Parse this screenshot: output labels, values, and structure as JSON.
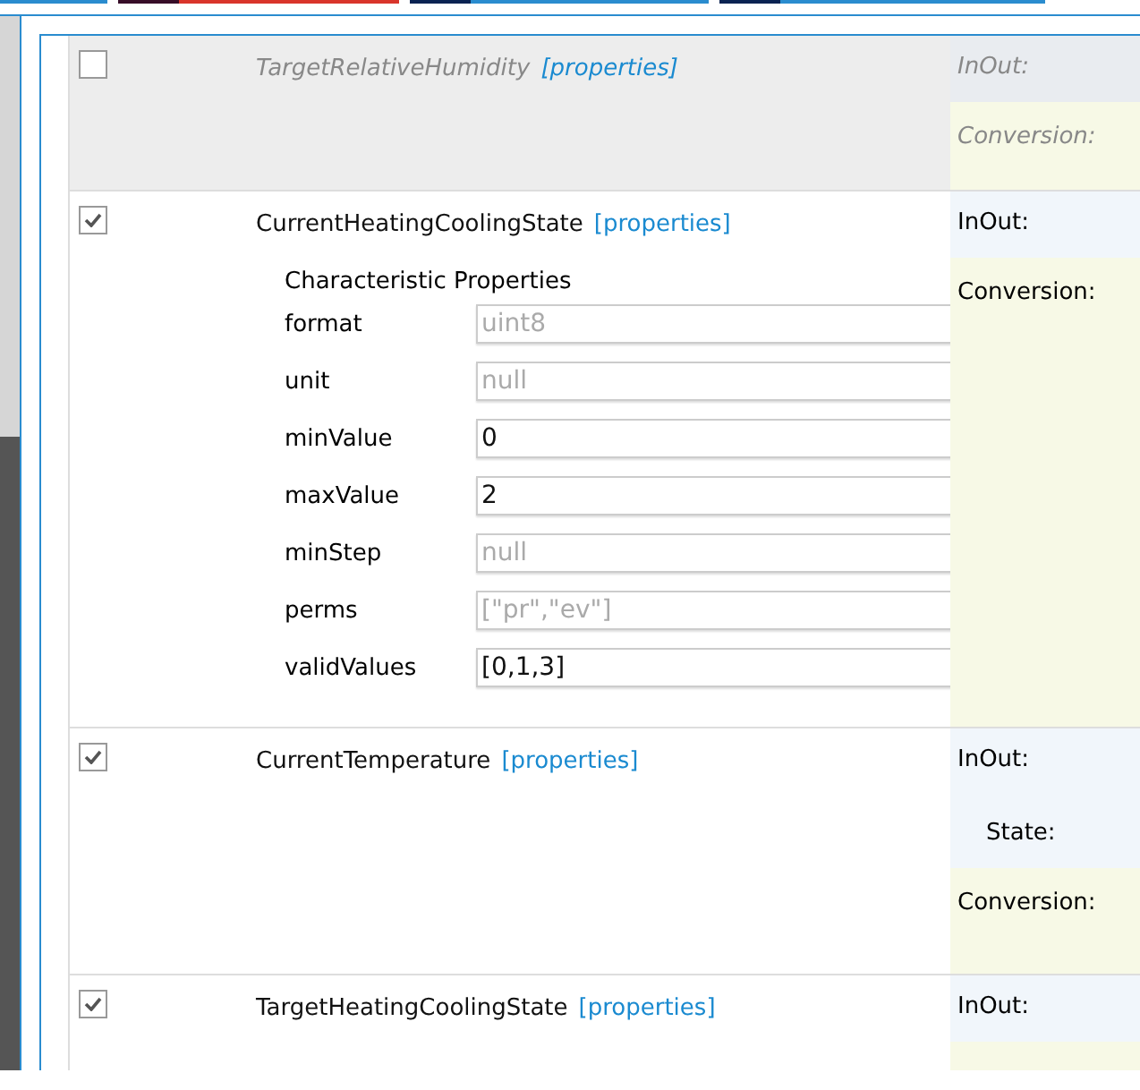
{
  "top_tabs": [
    {
      "color": "#2a8ccf"
    },
    {
      "color": "#d9352b"
    },
    {
      "color": "#2a8ccf"
    },
    {
      "color": "#2a8ccf"
    }
  ],
  "characteristics": [
    {
      "name": "TargetRelativeHumidity",
      "checked": false,
      "link": "[properties]",
      "side": [
        {
          "kind": "inout",
          "label": "InOut:"
        },
        {
          "kind": "conversion",
          "label": "Conversion:"
        }
      ]
    },
    {
      "name": "CurrentHeatingCoolingState",
      "checked": true,
      "link": "[properties]",
      "properties_title": "Characteristic Properties",
      "properties": [
        {
          "label": "format",
          "value": "uint8",
          "disabled": true
        },
        {
          "label": "unit",
          "value": "null",
          "disabled": true
        },
        {
          "label": "minValue",
          "value": "0",
          "disabled": false
        },
        {
          "label": "maxValue",
          "value": "2",
          "disabled": false
        },
        {
          "label": "minStep",
          "value": "null",
          "disabled": true
        },
        {
          "label": "perms",
          "value": "[\"pr\",\"ev\"]",
          "disabled": true
        },
        {
          "label": "validValues",
          "value": "[0,1,3]",
          "disabled": false
        }
      ],
      "side": [
        {
          "kind": "inout",
          "label": "InOut:"
        },
        {
          "kind": "conversion",
          "label": "Conversion:"
        }
      ]
    },
    {
      "name": "CurrentTemperature",
      "checked": true,
      "link": "[properties]",
      "side": [
        {
          "kind": "inout",
          "label": "InOut:"
        },
        {
          "kind": "state",
          "label": "State:"
        },
        {
          "kind": "conversion",
          "label": "Conversion:"
        }
      ]
    },
    {
      "name": "TargetHeatingCoolingState",
      "checked": true,
      "link": "[properties]",
      "side": [
        {
          "kind": "inout",
          "label": "InOut:"
        },
        {
          "kind": "conversion"
        }
      ]
    }
  ]
}
